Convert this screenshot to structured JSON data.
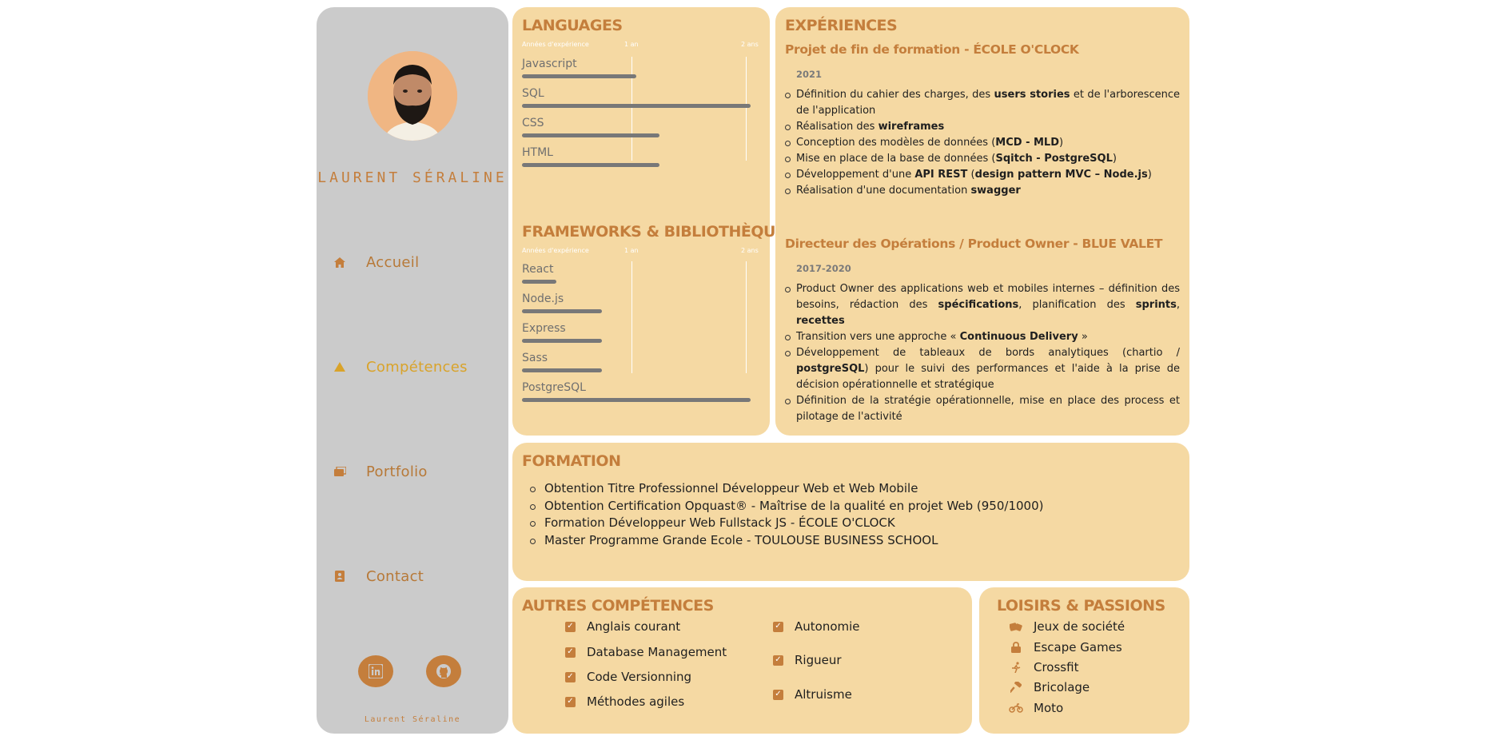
{
  "sidebar": {
    "name": "LAURENT SÉRALINE",
    "nav": [
      {
        "label": "Accueil",
        "icon": "home-icon"
      },
      {
        "label": "Compétences",
        "icon": "warning-triangle-icon"
      },
      {
        "label": "Portfolio",
        "icon": "images-icon"
      },
      {
        "label": "Contact",
        "icon": "contact-card-icon"
      }
    ],
    "social": [
      {
        "icon": "linkedin-icon"
      },
      {
        "icon": "github-icon"
      }
    ],
    "footer_name": "Laurent Séraline"
  },
  "languages": {
    "title": "LANGUAGES",
    "scale": {
      "start": "Années d'expérience",
      "mid": "1 an",
      "end": "2 ans"
    },
    "items": [
      {
        "name": "Javascript",
        "years": 1.0
      },
      {
        "name": "SQL",
        "years": 2.1
      },
      {
        "name": "CSS",
        "years": 1.2
      },
      {
        "name": "HTML",
        "years": 1.2
      }
    ]
  },
  "frameworks": {
    "title": "FRAMEWORKS & BIBLIOTHÈQUES",
    "scale": {
      "start": "Années d'expérience",
      "mid": "1 an",
      "end": "2 ans"
    },
    "items": [
      {
        "name": "React",
        "years": 0.3
      },
      {
        "name": "Node.js",
        "years": 0.7
      },
      {
        "name": "Express",
        "years": 0.7
      },
      {
        "name": "Sass",
        "years": 0.7
      },
      {
        "name": "PostgreSQL",
        "years": 2.1
      }
    ]
  },
  "experiences": {
    "title": "EXPÉRIENCES",
    "items": [
      {
        "title": "Projet de fin de formation - ÉCOLE O'CLOCK",
        "year": "2021",
        "bullets": [
          "Définition du cahier des charges, des <b>users stories</b> et de l'arborescence de l'application",
          "Réalisation des <b>wireframes</b>",
          "Conception des modèles de données (<b>MCD - MLD</b>)",
          "Mise en place de la base de données (<b>Sqitch - PostgreSQL</b>)",
          "Développement d'une <b>API REST</b> (<b>design pattern MVC – Node.js</b>)",
          "Réalisation d'une documentation <b>swagger</b>"
        ]
      },
      {
        "title": "Directeur des Opérations / Product Owner - BLUE VALET",
        "year": "2017-2020",
        "bullets": [
          "Product Owner des applications web et mobiles internes – définition des besoins, rédaction des <b>spécifications</b>, planification des <b>sprints</b>, <b>recettes</b>",
          "Transition vers une approche « <b>Continuous Delivery</b> »",
          "Développement de tableaux de bords analytiques (chartio / <b>postgreSQL</b>) pour le suivi des performances et l'aide à la prise de décision opérationnelle et stratégique",
          "Définition de la stratégie opérationnelle, mise en place des process et pilotage de l'activité"
        ]
      }
    ]
  },
  "formation": {
    "title": "FORMATION",
    "items": [
      "Obtention Titre Professionnel Développeur Web et Web Mobile",
      "Obtention Certification Opquast® - Maîtrise de la qualité en projet Web (950/1000)",
      "Formation Développeur Web Fullstack JS - ÉCOLE O'CLOCK",
      "Master Programme Grande Ecole - TOULOUSE BUSINESS SCHOOL"
    ]
  },
  "autres": {
    "title": "AUTRES COMPÉTENCES",
    "left": [
      "Anglais courant",
      "Database Management",
      "Code Versionning",
      "Méthodes agiles"
    ],
    "right": [
      "Autonomie",
      "Rigueur",
      "Altruisme"
    ]
  },
  "loisirs": {
    "title": "LOISIRS & PASSIONS",
    "items": [
      {
        "label": "Jeux de société",
        "icon": "dice-icon"
      },
      {
        "label": "Escape Games",
        "icon": "lock-icon"
      },
      {
        "label": "Crossfit",
        "icon": "running-icon"
      },
      {
        "label": "Bricolage",
        "icon": "hammer-icon"
      },
      {
        "label": "Moto",
        "icon": "motorcycle-icon"
      }
    ]
  },
  "colors": {
    "accent": "#c47e3c",
    "card": "#f5d9a3",
    "sidebar": "#cbcbcb",
    "bar": "#787878",
    "active": "#d9a32a"
  }
}
